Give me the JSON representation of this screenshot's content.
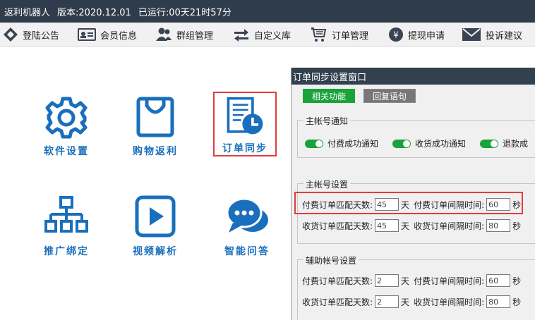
{
  "titlebar": {
    "app_name": "返利机器人",
    "version": "版本:2020.12.01",
    "uptime": "已运行:00天21时57分"
  },
  "menu": {
    "items": [
      {
        "label": "登陆公告",
        "icon": "diamond-arrows-icon"
      },
      {
        "label": "会员信息",
        "icon": "id-card-icon"
      },
      {
        "label": "群组管理",
        "icon": "users-icon"
      },
      {
        "label": "自定义库",
        "icon": "swap-arrows-icon"
      },
      {
        "label": "订单管理",
        "icon": "cart-icon"
      },
      {
        "label": "提现申请",
        "icon": "yen-coin-icon"
      },
      {
        "label": "投诉建议",
        "icon": "mail-icon"
      }
    ]
  },
  "tiles": [
    {
      "label": "软件设置",
      "icon": "gear-icon"
    },
    {
      "label": "购物返利",
      "icon": "shopping-bag-icon"
    },
    {
      "label": "订单同步",
      "icon": "order-sync-icon"
    },
    {
      "label": "推广绑定",
      "icon": "hierarchy-icon"
    },
    {
      "label": "视频解析",
      "icon": "play-video-icon"
    },
    {
      "label": "智能问答",
      "icon": "chat-bubbles-icon"
    }
  ],
  "dialog": {
    "title": "订单同步设置窗口",
    "tabs": [
      "相关功能",
      "回复语句"
    ],
    "main_notify": {
      "title": "主帐号通知",
      "toggles": [
        "付费成功通知",
        "收货成功通知",
        "退款成"
      ]
    },
    "main_settings": {
      "title": "主帐号设置",
      "pay_days_label": "付费订单匹配天数:",
      "pay_days": "45",
      "pay_interval_label": "付费订单间隔时间:",
      "pay_interval": "60",
      "recv_days_label": "收货订单匹配天数:",
      "recv_days": "45",
      "recv_interval_label": "收货订单间隔时间:",
      "recv_interval": "80"
    },
    "aux_settings": {
      "title": "辅助帐号设置",
      "pay_days_label": "付费订单匹配天数:",
      "pay_days": "2",
      "pay_interval_label": "付费订单间隔时间:",
      "pay_interval": "60",
      "recv_days_label": "收货订单匹配天数:",
      "recv_days": "2",
      "recv_interval_label": "收货订单间隔时间:",
      "recv_interval": "80"
    },
    "unit_day": "天",
    "unit_second": "秒"
  },
  "colors": {
    "accent_blue": "#1a6fbd",
    "highlight_red": "#e53b3b",
    "toggle_green": "#19a33a"
  }
}
